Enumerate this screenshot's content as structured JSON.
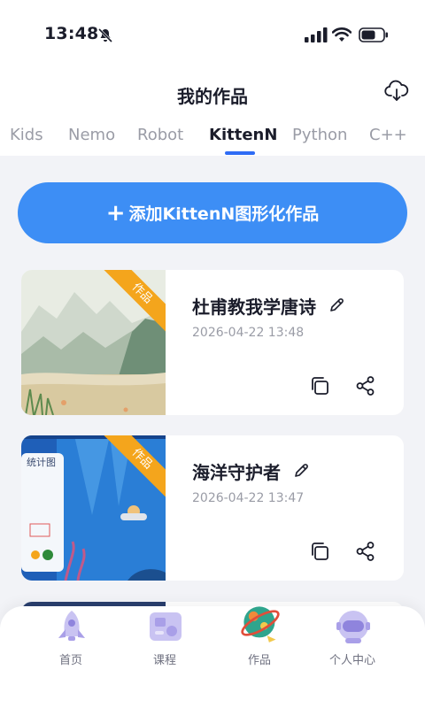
{
  "status_bar": {
    "time": "13:48"
  },
  "header": {
    "title": "我的作品",
    "download_icon": "cloud-download-icon"
  },
  "tabs": [
    {
      "label": "Kids",
      "active": false
    },
    {
      "label": "Nemo",
      "active": false
    },
    {
      "label": "Robot",
      "active": false
    },
    {
      "label": "KittenN",
      "active": true
    },
    {
      "label": "Python",
      "active": false
    },
    {
      "label": "C++",
      "active": false
    }
  ],
  "add_button": {
    "icon": "+",
    "label": "添加KittenN图形化作品"
  },
  "works": [
    {
      "title": "杜甫教我学唐诗",
      "time": "2026-04-22 13:48",
      "badge": "作品"
    },
    {
      "title": "海洋守护者",
      "time": "2026-04-22 13:47",
      "badge": "作品",
      "thumb_label": "统计图"
    }
  ],
  "bottom_nav": [
    {
      "label": "首页",
      "icon": "rocket-icon",
      "active": false
    },
    {
      "label": "课程",
      "icon": "course-icon",
      "active": false
    },
    {
      "label": "作品",
      "icon": "planet-icon",
      "active": true
    },
    {
      "label": "个人中心",
      "icon": "astronaut-icon",
      "active": false
    }
  ],
  "colors": {
    "accent": "#3d8ef5",
    "tab_indicator": "#2f6cf5",
    "badge": "#f4a51c",
    "background": "#f2f3f7"
  }
}
